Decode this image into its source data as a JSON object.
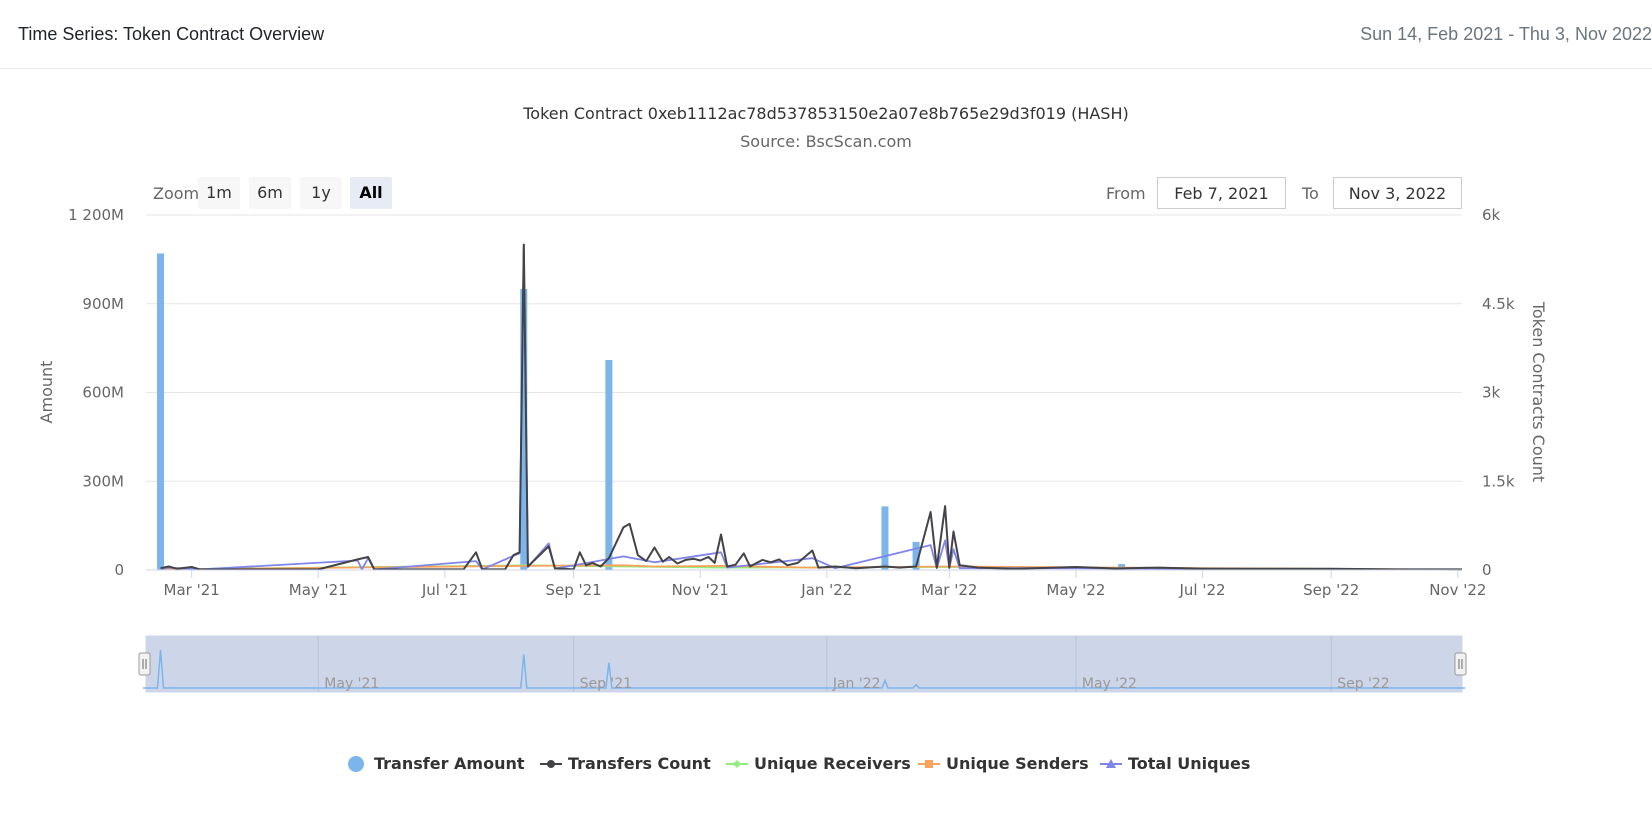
{
  "header": {
    "title": "Time Series: Token Contract Overview",
    "range": "Sun 14, Feb 2021 - Thu 3, Nov 2022"
  },
  "toolbar": {
    "zoom_label": "Zoom",
    "zoom_buttons": [
      "1m",
      "6m",
      "1y",
      "All"
    ],
    "active_zoom": "All",
    "from_label": "From",
    "from_value": "Feb 7, 2021",
    "to_label": "To",
    "to_value": "Nov 3, 2022"
  },
  "colors": {
    "transfer_amount": "#7cb5ec",
    "transfers_count": "#434348",
    "unique_receivers": "#90ed7d",
    "unique_senders": "#f7a35c",
    "total_uniques": "#8085e9",
    "navigator_fill": "#cdd5e8"
  },
  "chart_data": {
    "type": "bar+line",
    "title": "Token Contract 0xeb1112ac78d537853150e2a07e8b765e29d3f019 (HASH)",
    "subtitle": "Source: BscScan.com",
    "ylabel": "Amount",
    "y2label": "Token Contracts Count",
    "ylim": [
      0,
      1200000000
    ],
    "y2lim": [
      0,
      6000
    ],
    "yticks": [
      "0",
      "300M",
      "600M",
      "900M",
      "1 200M"
    ],
    "y2ticks": [
      "0",
      "1.5k",
      "3k",
      "4.5k",
      "6k"
    ],
    "xlim": [
      "2021-02-07",
      "2022-11-03"
    ],
    "xticks": [
      {
        "date": "2021-03-01",
        "label": "Mar '21"
      },
      {
        "date": "2021-05-01",
        "label": "May '21"
      },
      {
        "date": "2021-07-01",
        "label": "Jul '21"
      },
      {
        "date": "2021-09-01",
        "label": "Sep '21"
      },
      {
        "date": "2021-11-01",
        "label": "Nov '21"
      },
      {
        "date": "2022-01-01",
        "label": "Jan '22"
      },
      {
        "date": "2022-03-01",
        "label": "Mar '22"
      },
      {
        "date": "2022-05-01",
        "label": "May '22"
      },
      {
        "date": "2022-07-01",
        "label": "Jul '22"
      },
      {
        "date": "2022-09-01",
        "label": "Sep '22"
      },
      {
        "date": "2022-11-01",
        "label": "Nov '22"
      }
    ],
    "navigator_ticks": [
      {
        "date": "2021-05-01",
        "label": "May '21"
      },
      {
        "date": "2021-09-01",
        "label": "Sep '21"
      },
      {
        "date": "2022-01-01",
        "label": "Jan '22"
      },
      {
        "date": "2022-05-01",
        "label": "May '22"
      },
      {
        "date": "2022-09-01",
        "label": "Sep '22"
      }
    ],
    "legend_position": "bottom-center",
    "grid": true,
    "series": [
      {
        "name": "Transfer Amount",
        "type": "column",
        "axis": "left",
        "points": [
          [
            "2021-02-14",
            1070000000
          ],
          [
            "2021-02-20",
            3000000
          ],
          [
            "2021-04-25",
            4000000
          ],
          [
            "2021-08-08",
            950000000
          ],
          [
            "2021-09-18",
            710000000
          ],
          [
            "2022-01-29",
            215000000
          ],
          [
            "2022-02-13",
            95000000
          ],
          [
            "2022-05-23",
            20000000
          ],
          [
            "2022-06-10",
            3000000
          ]
        ]
      },
      {
        "name": "Transfers Count",
        "type": "line",
        "axis": "right",
        "points": [
          [
            "2021-02-14",
            30
          ],
          [
            "2021-02-18",
            60
          ],
          [
            "2021-02-22",
            20
          ],
          [
            "2021-03-01",
            50
          ],
          [
            "2021-03-05",
            10
          ],
          [
            "2021-04-01",
            10
          ],
          [
            "2021-05-01",
            10
          ],
          [
            "2021-05-20",
            180
          ],
          [
            "2021-05-25",
            220
          ],
          [
            "2021-05-28",
            10
          ],
          [
            "2021-07-10",
            10
          ],
          [
            "2021-07-16",
            300
          ],
          [
            "2021-07-19",
            10
          ],
          [
            "2021-07-30",
            10
          ],
          [
            "2021-08-03",
            250
          ],
          [
            "2021-08-06",
            300
          ],
          [
            "2021-08-08",
            5500
          ],
          [
            "2021-08-10",
            60
          ],
          [
            "2021-08-20",
            400
          ],
          [
            "2021-08-23",
            30
          ],
          [
            "2021-09-01",
            10
          ],
          [
            "2021-09-04",
            300
          ],
          [
            "2021-09-07",
            80
          ],
          [
            "2021-09-10",
            120
          ],
          [
            "2021-09-14",
            60
          ],
          [
            "2021-09-18",
            200
          ],
          [
            "2021-09-25",
            720
          ],
          [
            "2021-09-28",
            780
          ],
          [
            "2021-10-02",
            250
          ],
          [
            "2021-10-06",
            150
          ],
          [
            "2021-10-10",
            380
          ],
          [
            "2021-10-14",
            140
          ],
          [
            "2021-10-17",
            220
          ],
          [
            "2021-10-21",
            110
          ],
          [
            "2021-10-25",
            170
          ],
          [
            "2021-10-29",
            190
          ],
          [
            "2021-11-01",
            160
          ],
          [
            "2021-11-05",
            220
          ],
          [
            "2021-11-08",
            120
          ],
          [
            "2021-11-11",
            600
          ],
          [
            "2021-11-14",
            60
          ],
          [
            "2021-11-18",
            90
          ],
          [
            "2021-11-22",
            280
          ],
          [
            "2021-11-25",
            60
          ],
          [
            "2021-12-01",
            170
          ],
          [
            "2021-12-05",
            130
          ],
          [
            "2021-12-09",
            180
          ],
          [
            "2021-12-13",
            80
          ],
          [
            "2021-12-18",
            120
          ],
          [
            "2021-12-25",
            330
          ],
          [
            "2021-12-28",
            40
          ],
          [
            "2022-01-05",
            60
          ],
          [
            "2022-01-15",
            30
          ],
          [
            "2022-01-29",
            60
          ],
          [
            "2022-02-05",
            40
          ],
          [
            "2022-02-13",
            60
          ],
          [
            "2022-02-20",
            980
          ],
          [
            "2022-02-23",
            40
          ],
          [
            "2022-02-27",
            1080
          ],
          [
            "2022-03-01",
            40
          ],
          [
            "2022-03-03",
            650
          ],
          [
            "2022-03-06",
            80
          ],
          [
            "2022-03-15",
            40
          ],
          [
            "2022-04-01",
            20
          ],
          [
            "2022-05-01",
            50
          ],
          [
            "2022-05-20",
            25
          ],
          [
            "2022-06-10",
            40
          ],
          [
            "2022-07-01",
            20
          ],
          [
            "2022-09-01",
            20
          ],
          [
            "2022-10-01",
            10
          ],
          [
            "2022-11-03",
            10
          ]
        ]
      },
      {
        "name": "Unique Receivers",
        "type": "line",
        "axis": "right",
        "points": [
          [
            "2021-02-14",
            10
          ],
          [
            "2021-08-08",
            80
          ],
          [
            "2021-09-25",
            60
          ],
          [
            "2021-11-11",
            40
          ],
          [
            "2022-02-27",
            50
          ],
          [
            "2022-11-03",
            5
          ]
        ]
      },
      {
        "name": "Unique Senders",
        "type": "line",
        "axis": "right",
        "points": [
          [
            "2021-02-14",
            10
          ],
          [
            "2021-08-08",
            70
          ],
          [
            "2021-09-25",
            80
          ],
          [
            "2021-10-10",
            60
          ],
          [
            "2021-11-11",
            70
          ],
          [
            "2021-12-25",
            40
          ],
          [
            "2022-02-27",
            60
          ],
          [
            "2022-11-03",
            5
          ]
        ]
      },
      {
        "name": "Total Uniques",
        "type": "line",
        "axis": "right",
        "points": [
          [
            "2021-02-14",
            20
          ],
          [
            "2021-02-18",
            40
          ],
          [
            "2021-03-05",
            10
          ],
          [
            "2021-05-20",
            160
          ],
          [
            "2021-05-22",
            10
          ],
          [
            "2021-05-25",
            200
          ],
          [
            "2021-05-28",
            10
          ],
          [
            "2021-07-16",
            150
          ],
          [
            "2021-07-19",
            10
          ],
          [
            "2021-08-03",
            240
          ],
          [
            "2021-08-06",
            280
          ],
          [
            "2021-08-08",
            5500
          ],
          [
            "2021-08-10",
            50
          ],
          [
            "2021-08-20",
            450
          ],
          [
            "2021-08-23",
            20
          ],
          [
            "2021-09-25",
            230
          ],
          [
            "2021-10-10",
            130
          ],
          [
            "2021-11-11",
            300
          ],
          [
            "2021-11-14",
            40
          ],
          [
            "2021-12-25",
            200
          ],
          [
            "2022-01-05",
            30
          ],
          [
            "2022-02-20",
            420
          ],
          [
            "2022-02-23",
            30
          ],
          [
            "2022-02-27",
            500
          ],
          [
            "2022-03-01",
            30
          ],
          [
            "2022-03-03",
            350
          ],
          [
            "2022-03-06",
            30
          ],
          [
            "2022-05-01",
            30
          ],
          [
            "2022-11-03",
            5
          ]
        ]
      }
    ]
  }
}
